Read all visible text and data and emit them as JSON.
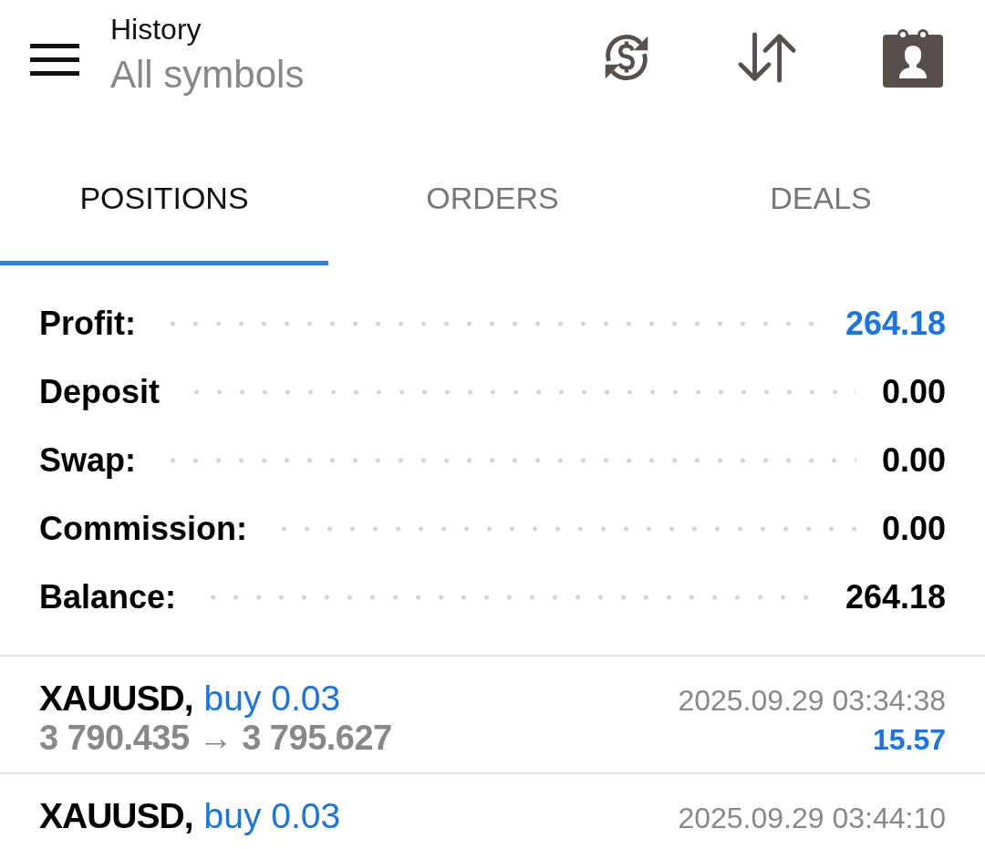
{
  "header": {
    "title": "History",
    "subtitle": "All symbols"
  },
  "tabs": [
    {
      "label": "POSITIONS",
      "selected": true
    },
    {
      "label": "ORDERS",
      "selected": false
    },
    {
      "label": "DEALS",
      "selected": false
    }
  ],
  "summary": [
    {
      "label": "Profit:",
      "value": "264.18",
      "color": "#1a73e8"
    },
    {
      "label": "Deposit",
      "value": "0.00",
      "color": "#000000"
    },
    {
      "label": "Swap:",
      "value": "0.00",
      "color": "#000000"
    },
    {
      "label": "Commission:",
      "value": "0.00",
      "color": "#000000"
    },
    {
      "label": "Balance:",
      "value": "264.18",
      "color": "#000000"
    }
  ],
  "trades": [
    {
      "symbol": "XAUUSD,",
      "side": "buy 0.03",
      "time": "2025.09.29 03:34:38",
      "prices": "3 790.435 → 3 795.627",
      "profit": "15.57"
    },
    {
      "symbol": "XAUUSD,",
      "side": "buy 0.03",
      "time": "2025.09.29 03:44:10"
    }
  ]
}
